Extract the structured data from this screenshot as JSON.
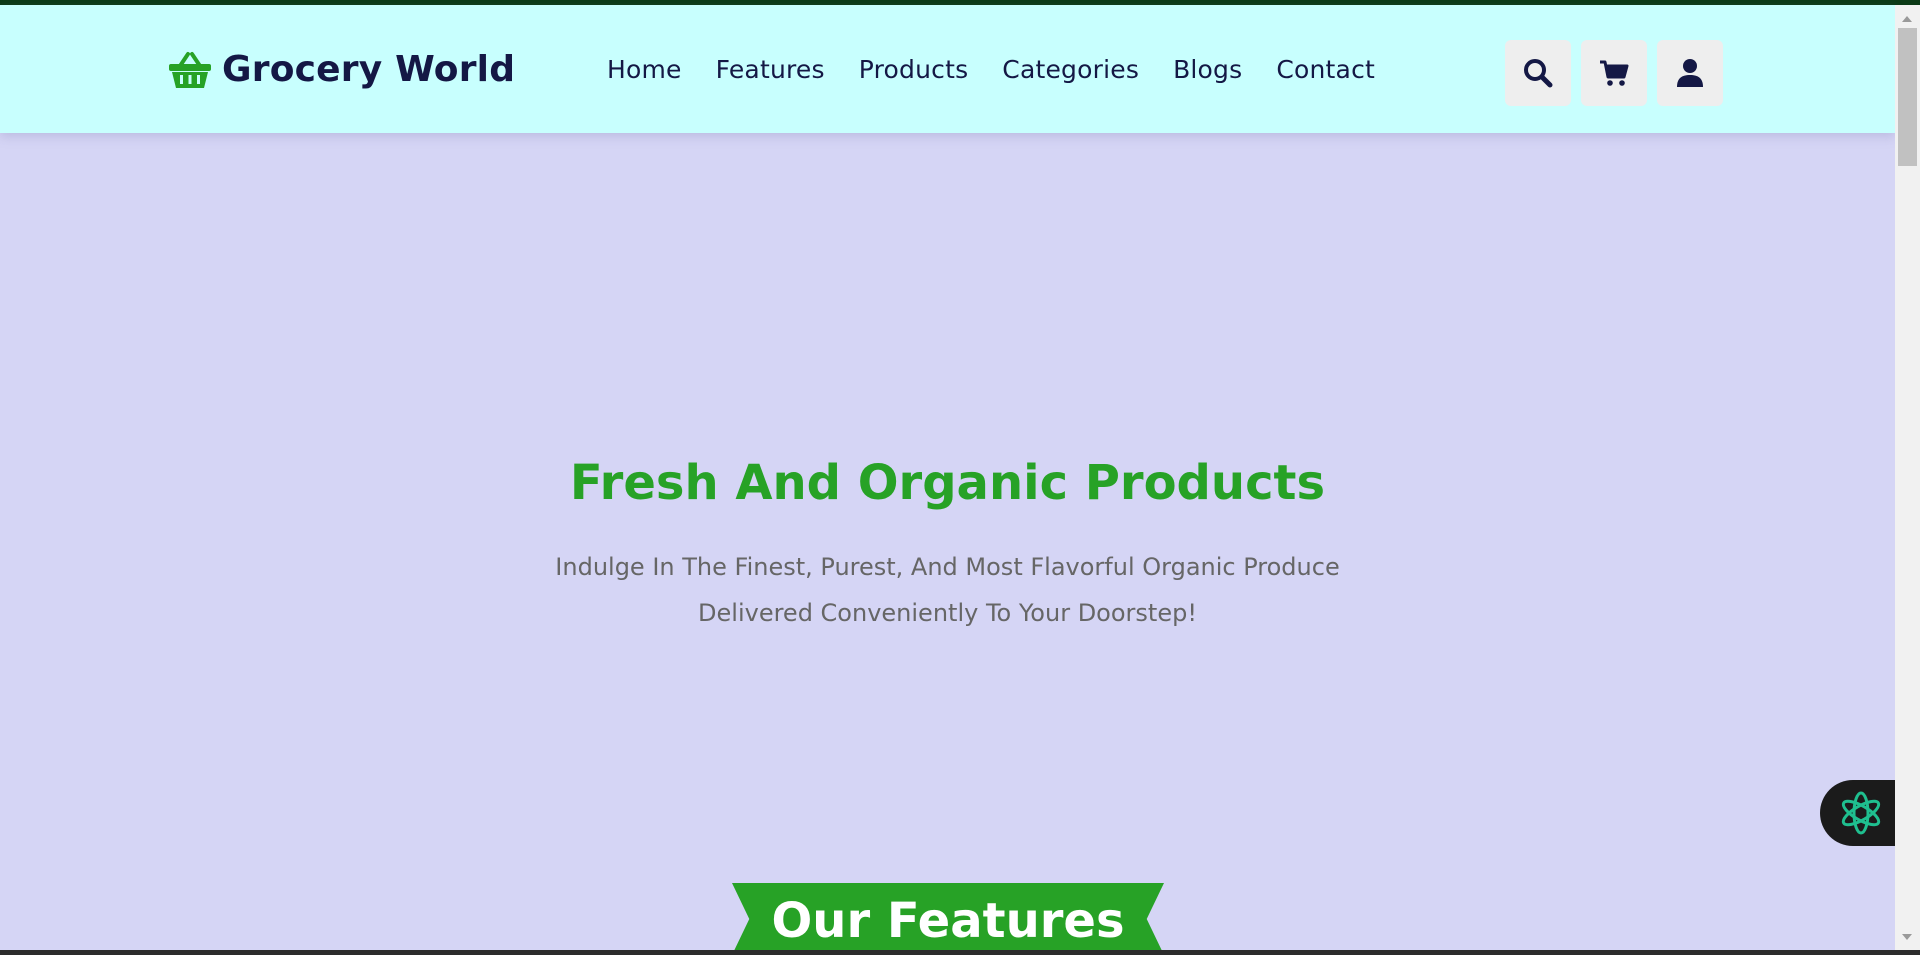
{
  "header": {
    "brand": "Grocery World",
    "nav": [
      "Home",
      "Features",
      "Products",
      "Categories",
      "Blogs",
      "Contact"
    ],
    "icons": [
      "search-icon",
      "cart-icon",
      "user-icon"
    ]
  },
  "hero": {
    "title": "Fresh And Organic Products",
    "subtitle_line1": "Indulge In The Finest, Purest, And Most Flavorful Organic Produce",
    "subtitle_line2": "Delivered Conveniently To Your Doorstep!"
  },
  "section": {
    "heading": "Our Features"
  },
  "colors": {
    "brand_green": "#27a226",
    "navy": "#141845",
    "header_bg": "#c8fffe",
    "page_bg": "#d5d5f5"
  }
}
